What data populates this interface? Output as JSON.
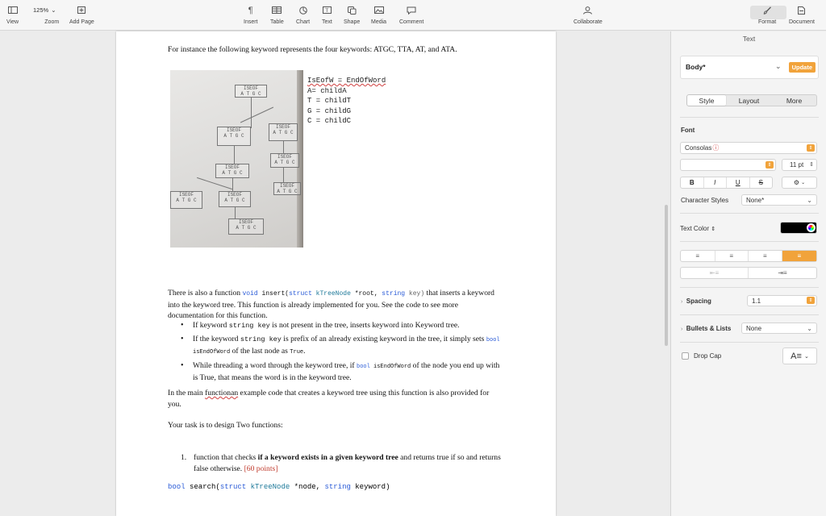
{
  "toolbar": {
    "view": "View",
    "zoom_value": "125%",
    "zoom": "Zoom",
    "add_page": "Add Page",
    "insert": "Insert",
    "table": "Table",
    "chart": "Chart",
    "text": "Text",
    "shape": "Shape",
    "media": "Media",
    "comment": "Comment",
    "collaborate": "Collaborate",
    "format": "Format",
    "document": "Document"
  },
  "document": {
    "intro": "For instance the following keyword represents the four keywords: ATGC, TTA, AT, and ATA.",
    "photo_code": [
      "IsEofW = EndOfWord",
      "A= childA",
      "T = childT",
      "G = childG",
      "C = childC"
    ],
    "photo_nodes": [
      "ISEOF",
      "A T G C"
    ],
    "para1_a": "There is also a function ",
    "para1_code1": "void",
    "para1_code2": " insert(",
    "para1_code3": "struct",
    "para1_code4": " kTreeNode ",
    "para1_code5": "*root, ",
    "para1_code6": "string",
    "para1_code7": " key)",
    "para1_b": " that inserts a keyword into the keyword tree. This function is already implemented for you. See the code to see more documentation for this function.",
    "bullet1_a": "If keyword ",
    "bullet1_code": "string key",
    "bullet1_b": " is not present in the tree, inserts keyword into Keyword tree.",
    "bullet2_a": "If the keyword ",
    "bullet2_code": "string key",
    "bullet2_b": " is prefix of an already existing keyword in the tree, it simply sets ",
    "bullet2_code2": "bool",
    "bullet2_code3": " isEndOfWord",
    "bullet2_c": " of the last node as ",
    "bullet2_code4": "True",
    "bullet2_d": ".",
    "bullet3_a": "While threading a word through the keyword tree, if ",
    "bullet3_code": "bool",
    "bullet3_code2": " isEndOfWord",
    "bullet3_b": " of the node you end up with is True, that means the word is in the keyword tree.",
    "para2_a": "In the main ",
    "para2_misspelled": "functionan",
    "para2_b": " example code that creates a keyword tree using this function is also provided for you.",
    "para3": "Your task is to design Two functions:",
    "item1_num": "1.",
    "item1_a": "function that checks ",
    "item1_bold": "if a keyword exists in a given keyword tree",
    "item1_b": " and returns true if so and returns false otherwise. ",
    "item1_points": "[60 points]",
    "code_line_1": "bool",
    "code_line_2": " search(",
    "code_line_3": "struct",
    "code_line_4": " kTreeNode ",
    "code_line_5": "*node, ",
    "code_line_6": "string",
    "code_line_7": " keyword)"
  },
  "inspector": {
    "title": "Text",
    "paragraph_style": "Body*",
    "update": "Update",
    "tabs": [
      "Style",
      "Layout",
      "More"
    ],
    "font_label": "Font",
    "font_name": "Consolas",
    "font_warning": "ⓘ",
    "font_size": "11 pt",
    "bold": "B",
    "italic": "I",
    "underline": "U",
    "strike": "S",
    "char_styles_label": "Character Styles",
    "char_styles_value": "None*",
    "text_color_label": "Text Color",
    "spacing_label": "Spacing",
    "spacing_value": "1.1",
    "bullets_label": "Bullets & Lists",
    "bullets_value": "None",
    "drop_cap_label": "Drop Cap",
    "text_color": "#000000",
    "accent": "#f1a33b"
  }
}
